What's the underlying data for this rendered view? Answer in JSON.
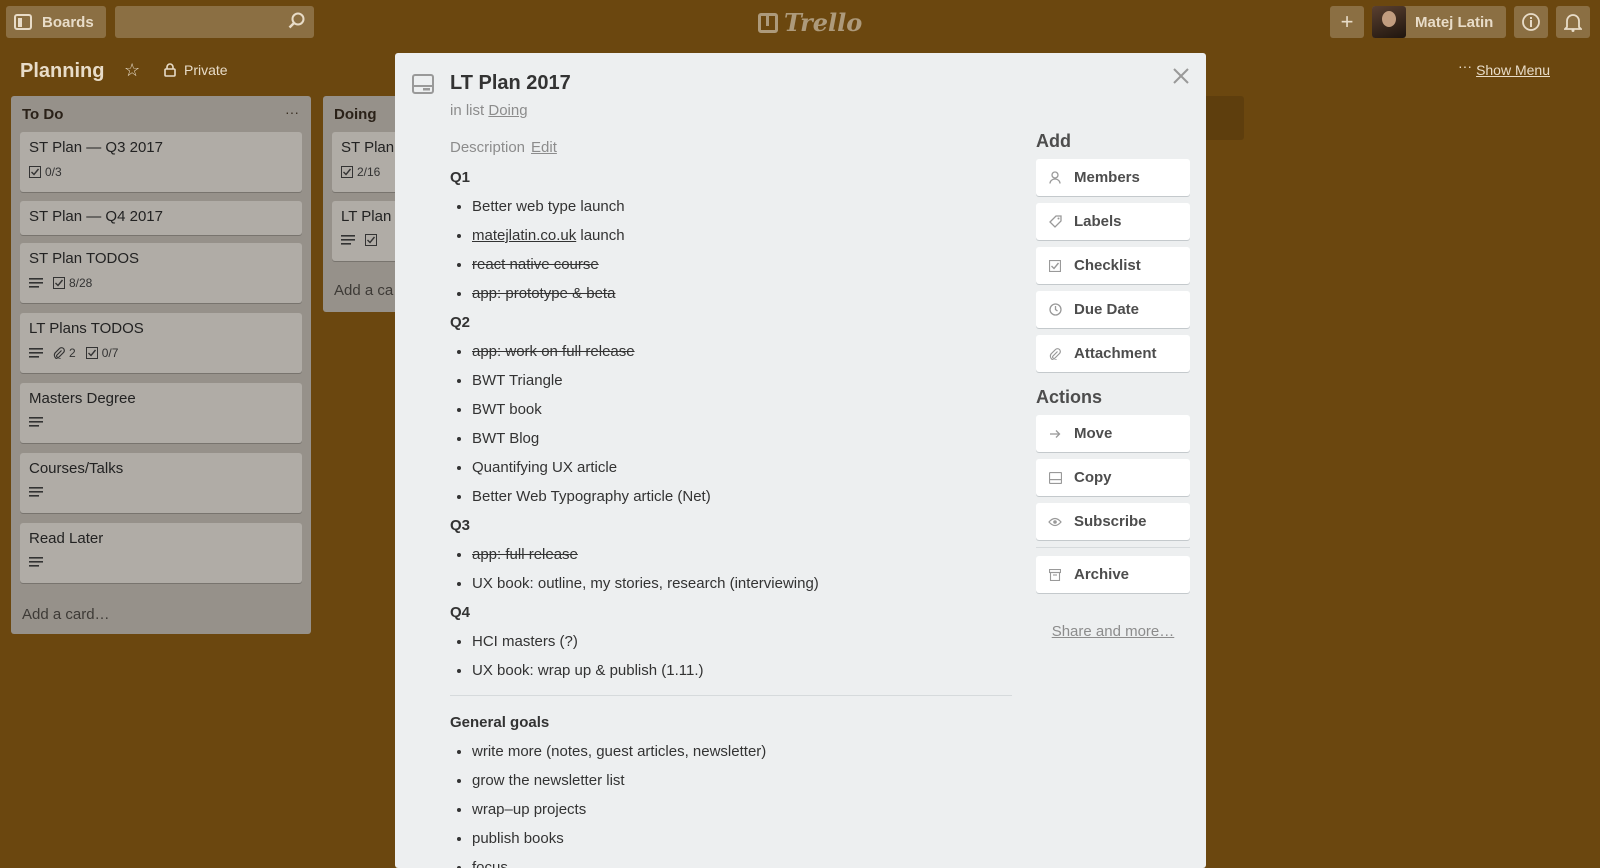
{
  "topbar": {
    "boards_label": "Boards",
    "logo_text": "Trello",
    "user_name": "Matej Latin"
  },
  "board": {
    "title": "Planning",
    "privacy": "Private",
    "show_menu": "Show Menu",
    "more": "···"
  },
  "lists": [
    {
      "name": "To Do",
      "menu": "···",
      "cards": [
        {
          "title": "ST Plan — Q3 2017",
          "checklist": "0/3"
        },
        {
          "title": "ST Plan — Q4 2017"
        },
        {
          "title": "ST Plan TODOS",
          "checklist": "8/28"
        },
        {
          "title": "LT Plans TODOS",
          "attachments": "2",
          "checklist": "0/7"
        },
        {
          "title": "Masters Degree"
        },
        {
          "title": "Courses/Talks"
        },
        {
          "title": "Read Later"
        }
      ],
      "add_card": "Add a card…"
    },
    {
      "name": "Doing",
      "cards": [
        {
          "title": "ST Plan",
          "checklist": "2/16"
        },
        {
          "title": "LT Plan"
        }
      ],
      "add_card": "Add a ca"
    }
  ],
  "modal": {
    "title": "LT Plan 2017",
    "in_list_prefix": "in list",
    "in_list_name": "Doing",
    "description_label": "Description",
    "edit_label": "Edit",
    "sections": [
      {
        "title": "Q1",
        "items": [
          {
            "text": "Better web type launch",
            "done": false
          },
          {
            "link": "matejlatin.co.uk",
            "text": " launch",
            "done": false
          },
          {
            "text": "react native course",
            "done": true
          },
          {
            "text": "app: prototype & beta",
            "done": true
          }
        ]
      },
      {
        "title": "Q2",
        "items": [
          {
            "text": "app: work on full release",
            "done": true
          },
          {
            "text": "BWT Triangle",
            "done": false
          },
          {
            "text": "BWT book",
            "done": false
          },
          {
            "text": "BWT Blog",
            "done": false
          },
          {
            "text": "Quantifying UX article",
            "done": false
          },
          {
            "text": "Better Web Typography article (Net)",
            "done": false
          }
        ]
      },
      {
        "title": "Q3",
        "items": [
          {
            "text": "app: full release",
            "done": true
          },
          {
            "text": "UX book: outline, my stories, research (interviewing)",
            "done": false
          }
        ]
      },
      {
        "title": "Q4",
        "items": [
          {
            "text": "HCI masters (?)",
            "done": false
          },
          {
            "text": "UX book: wrap up & publish (1.11.)",
            "done": false
          }
        ]
      }
    ],
    "general_goals_title": "General goals",
    "general_goals": [
      "write more (notes, guest articles, newsletter)",
      "grow the newsletter list",
      "wrap–up projects",
      "publish books",
      "focus"
    ],
    "sidebar": {
      "add_title": "Add",
      "add_buttons": [
        {
          "label": "Members",
          "icon": "person-icon"
        },
        {
          "label": "Labels",
          "icon": "tag-icon"
        },
        {
          "label": "Checklist",
          "icon": "checkbox-icon"
        },
        {
          "label": "Due Date",
          "icon": "clock-icon"
        },
        {
          "label": "Attachment",
          "icon": "paperclip-icon"
        }
      ],
      "actions_title": "Actions",
      "action_buttons": [
        {
          "label": "Move",
          "icon": "arrow-right-icon"
        },
        {
          "label": "Copy",
          "icon": "card-icon"
        },
        {
          "label": "Subscribe",
          "icon": "eye-icon"
        },
        {
          "label": "Archive",
          "icon": "archive-icon"
        }
      ],
      "share_label": "Share and more…"
    }
  }
}
